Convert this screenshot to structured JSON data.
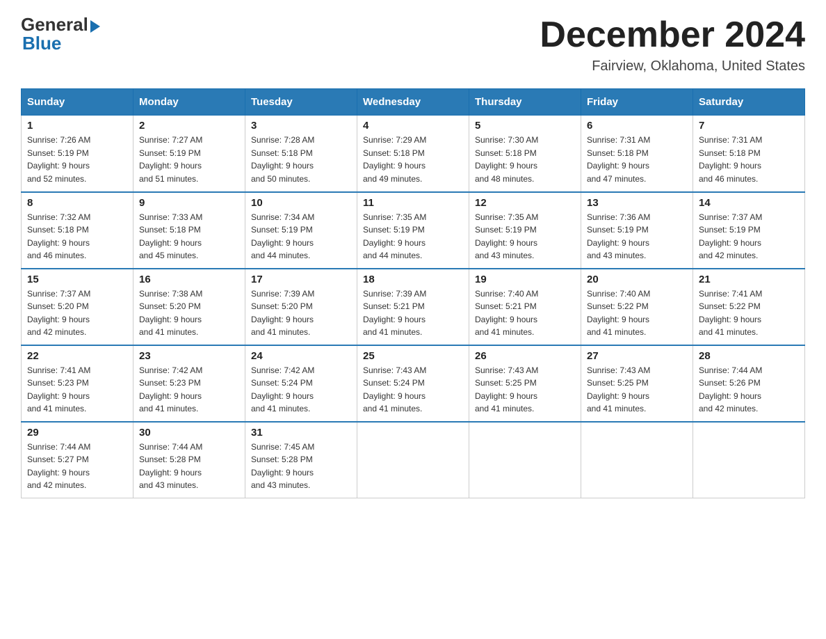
{
  "header": {
    "logo_general": "General",
    "logo_blue": "Blue",
    "month_title": "December 2024",
    "location": "Fairview, Oklahoma, United States"
  },
  "days_of_week": [
    "Sunday",
    "Monday",
    "Tuesday",
    "Wednesday",
    "Thursday",
    "Friday",
    "Saturday"
  ],
  "weeks": [
    [
      {
        "day": "1",
        "sunrise": "7:26 AM",
        "sunset": "5:19 PM",
        "daylight": "9 hours and 52 minutes."
      },
      {
        "day": "2",
        "sunrise": "7:27 AM",
        "sunset": "5:19 PM",
        "daylight": "9 hours and 51 minutes."
      },
      {
        "day": "3",
        "sunrise": "7:28 AM",
        "sunset": "5:18 PM",
        "daylight": "9 hours and 50 minutes."
      },
      {
        "day": "4",
        "sunrise": "7:29 AM",
        "sunset": "5:18 PM",
        "daylight": "9 hours and 49 minutes."
      },
      {
        "day": "5",
        "sunrise": "7:30 AM",
        "sunset": "5:18 PM",
        "daylight": "9 hours and 48 minutes."
      },
      {
        "day": "6",
        "sunrise": "7:31 AM",
        "sunset": "5:18 PM",
        "daylight": "9 hours and 47 minutes."
      },
      {
        "day": "7",
        "sunrise": "7:31 AM",
        "sunset": "5:18 PM",
        "daylight": "9 hours and 46 minutes."
      }
    ],
    [
      {
        "day": "8",
        "sunrise": "7:32 AM",
        "sunset": "5:18 PM",
        "daylight": "9 hours and 46 minutes."
      },
      {
        "day": "9",
        "sunrise": "7:33 AM",
        "sunset": "5:18 PM",
        "daylight": "9 hours and 45 minutes."
      },
      {
        "day": "10",
        "sunrise": "7:34 AM",
        "sunset": "5:19 PM",
        "daylight": "9 hours and 44 minutes."
      },
      {
        "day": "11",
        "sunrise": "7:35 AM",
        "sunset": "5:19 PM",
        "daylight": "9 hours and 44 minutes."
      },
      {
        "day": "12",
        "sunrise": "7:35 AM",
        "sunset": "5:19 PM",
        "daylight": "9 hours and 43 minutes."
      },
      {
        "day": "13",
        "sunrise": "7:36 AM",
        "sunset": "5:19 PM",
        "daylight": "9 hours and 43 minutes."
      },
      {
        "day": "14",
        "sunrise": "7:37 AM",
        "sunset": "5:19 PM",
        "daylight": "9 hours and 42 minutes."
      }
    ],
    [
      {
        "day": "15",
        "sunrise": "7:37 AM",
        "sunset": "5:20 PM",
        "daylight": "9 hours and 42 minutes."
      },
      {
        "day": "16",
        "sunrise": "7:38 AM",
        "sunset": "5:20 PM",
        "daylight": "9 hours and 41 minutes."
      },
      {
        "day": "17",
        "sunrise": "7:39 AM",
        "sunset": "5:20 PM",
        "daylight": "9 hours and 41 minutes."
      },
      {
        "day": "18",
        "sunrise": "7:39 AM",
        "sunset": "5:21 PM",
        "daylight": "9 hours and 41 minutes."
      },
      {
        "day": "19",
        "sunrise": "7:40 AM",
        "sunset": "5:21 PM",
        "daylight": "9 hours and 41 minutes."
      },
      {
        "day": "20",
        "sunrise": "7:40 AM",
        "sunset": "5:22 PM",
        "daylight": "9 hours and 41 minutes."
      },
      {
        "day": "21",
        "sunrise": "7:41 AM",
        "sunset": "5:22 PM",
        "daylight": "9 hours and 41 minutes."
      }
    ],
    [
      {
        "day": "22",
        "sunrise": "7:41 AM",
        "sunset": "5:23 PM",
        "daylight": "9 hours and 41 minutes."
      },
      {
        "day": "23",
        "sunrise": "7:42 AM",
        "sunset": "5:23 PM",
        "daylight": "9 hours and 41 minutes."
      },
      {
        "day": "24",
        "sunrise": "7:42 AM",
        "sunset": "5:24 PM",
        "daylight": "9 hours and 41 minutes."
      },
      {
        "day": "25",
        "sunrise": "7:43 AM",
        "sunset": "5:24 PM",
        "daylight": "9 hours and 41 minutes."
      },
      {
        "day": "26",
        "sunrise": "7:43 AM",
        "sunset": "5:25 PM",
        "daylight": "9 hours and 41 minutes."
      },
      {
        "day": "27",
        "sunrise": "7:43 AM",
        "sunset": "5:25 PM",
        "daylight": "9 hours and 41 minutes."
      },
      {
        "day": "28",
        "sunrise": "7:44 AM",
        "sunset": "5:26 PM",
        "daylight": "9 hours and 42 minutes."
      }
    ],
    [
      {
        "day": "29",
        "sunrise": "7:44 AM",
        "sunset": "5:27 PM",
        "daylight": "9 hours and 42 minutes."
      },
      {
        "day": "30",
        "sunrise": "7:44 AM",
        "sunset": "5:28 PM",
        "daylight": "9 hours and 43 minutes."
      },
      {
        "day": "31",
        "sunrise": "7:45 AM",
        "sunset": "5:28 PM",
        "daylight": "9 hours and 43 minutes."
      },
      null,
      null,
      null,
      null
    ]
  ],
  "labels": {
    "sunrise": "Sunrise:",
    "sunset": "Sunset:",
    "daylight": "Daylight:"
  }
}
